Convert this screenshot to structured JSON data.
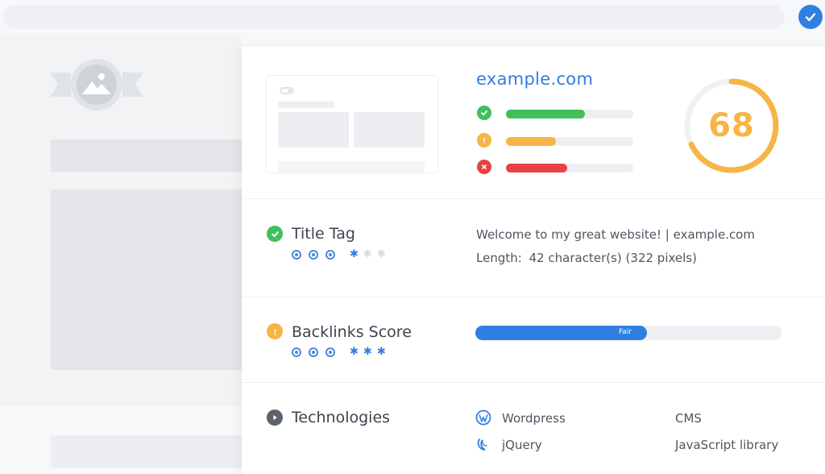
{
  "status": {
    "checked": true
  },
  "preview": {
    "domain": "example.com"
  },
  "quality_bars": [
    {
      "status": "pass",
      "color": "#40bf5c",
      "fill_fraction": 0.62
    },
    {
      "status": "warning",
      "color": "#f6b545",
      "fill_fraction": 0.39
    },
    {
      "status": "error",
      "color": "#e84343",
      "fill_fraction": 0.48
    }
  ],
  "score": {
    "value": "68",
    "color": "#f6b545",
    "fraction": 0.68
  },
  "title_tag": {
    "label": "Title Tag",
    "status": "pass",
    "text": "Welcome to my great website! | example.com",
    "length_label": "Length:",
    "length_value": "42 character(s) (322 pixels)",
    "importance": 3,
    "difficulty": 1
  },
  "backlinks": {
    "label": "Backlinks Score",
    "status": "warning",
    "bar_label": "Fair",
    "bar_fraction": 0.56,
    "importance": 3,
    "difficulty": 3
  },
  "technologies": {
    "label": "Technologies",
    "items": [
      {
        "name": "Wordpress",
        "category": "CMS",
        "icon": "wordpress-icon"
      },
      {
        "name": "jQuery",
        "category": "JavaScript library",
        "icon": "jquery-icon"
      }
    ]
  },
  "colors": {
    "accent": "#2f7fe0",
    "pass": "#40bf5c",
    "warning": "#f6b545",
    "error": "#e84343"
  }
}
